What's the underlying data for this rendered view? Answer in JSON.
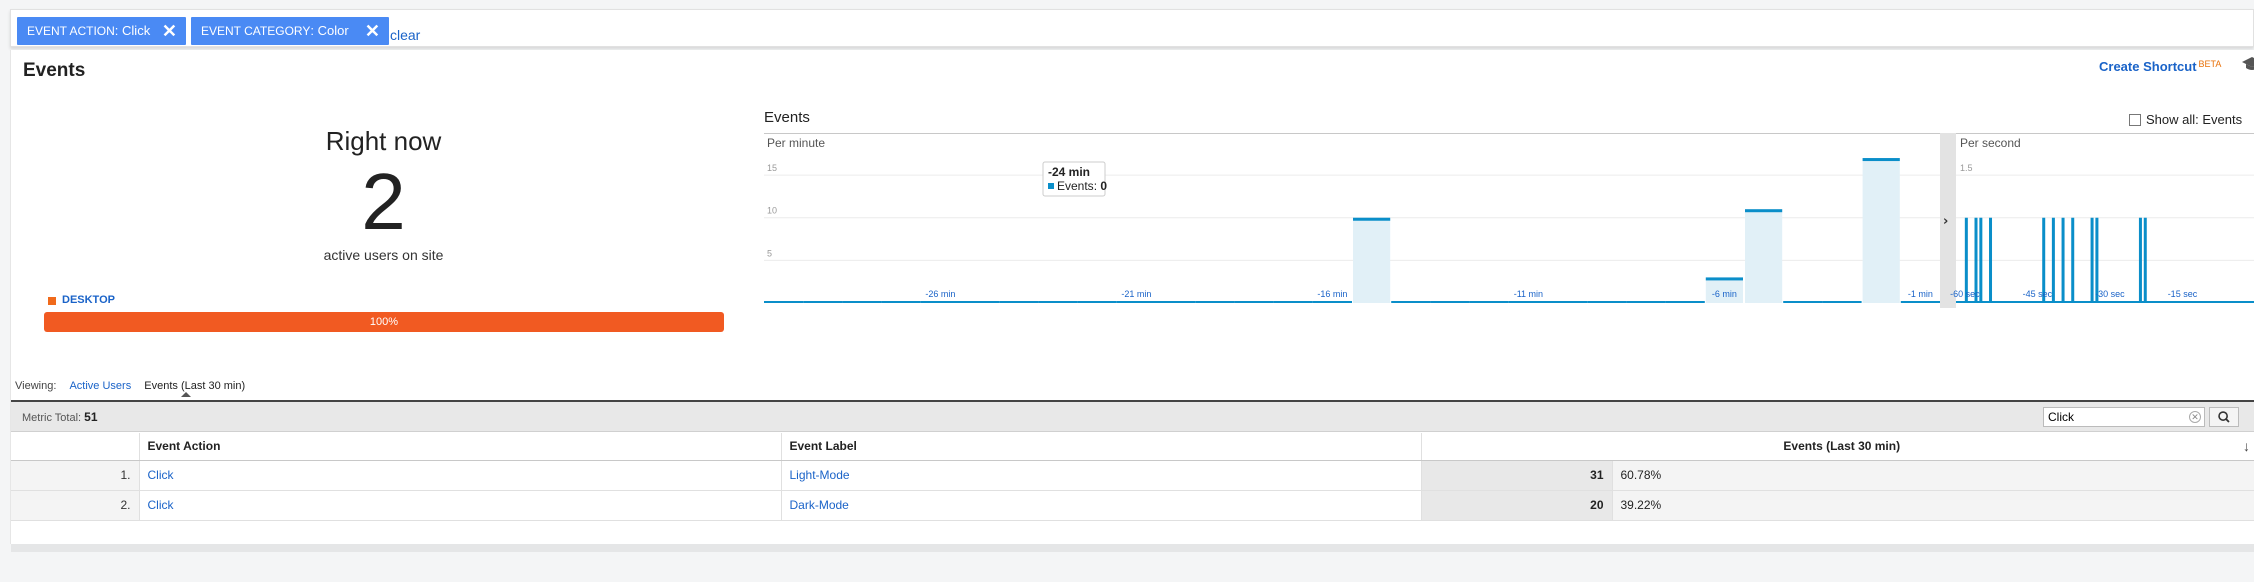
{
  "filters": [
    {
      "key": "EVENT ACTION",
      "value": "Click"
    },
    {
      "key": "EVENT CATEGORY",
      "value": "Color"
    }
  ],
  "clear_label": "clear",
  "page_title": "Events",
  "shortcut": {
    "label": "Create Shortcut",
    "badge": "BETA"
  },
  "right_now": {
    "label": "Right now",
    "count": "2",
    "sublabel": "active users on site",
    "device": "DESKTOP",
    "device_percent": "100%",
    "device_color": "#f15a22"
  },
  "events_panel": {
    "title": "Events",
    "show_all": "Show all: Events",
    "per_minute": "Per minute",
    "per_second": "Per second",
    "tooltip": {
      "title": "-24 min",
      "series": "Events",
      "value": "0"
    }
  },
  "chart_data": [
    {
      "type": "bar",
      "title": "Per minute",
      "x": [
        -30,
        -29,
        -28,
        -27,
        -26,
        -25,
        -24,
        -23,
        -22,
        -21,
        -20,
        -19,
        -18,
        -17,
        -16,
        -15,
        -14,
        -13,
        -12,
        -11,
        -10,
        -9,
        -8,
        -7,
        -6,
        -5,
        -4,
        -3,
        -2,
        -1
      ],
      "values": [
        0,
        0,
        0,
        0,
        0,
        0,
        0,
        0,
        0,
        0,
        0,
        0,
        0,
        0,
        0,
        10,
        0,
        0,
        0,
        0,
        0,
        0,
        0,
        0,
        3,
        11,
        0,
        0,
        17,
        0
      ],
      "x_ticks": [
        "-26 min",
        "-21 min",
        "-16 min",
        "-11 min",
        "-6 min",
        "-1 min"
      ],
      "y_ticks": [
        "5",
        "10",
        "15"
      ],
      "ylim": [
        0,
        19
      ],
      "color": "#0a8ec9",
      "fill": "#e1f0f7"
    },
    {
      "type": "bar",
      "title": "Per second",
      "x_ticks": [
        "-60 sec",
        "-45 sec",
        "-30 sec",
        "-15 sec"
      ],
      "y_ticks": [
        "1.5"
      ],
      "spikes_sec": [
        -60,
        -58,
        -57,
        -55,
        -44,
        -42,
        -40,
        -38,
        -34,
        -33,
        -24,
        -23
      ],
      "spike_value": 1,
      "ylim": [
        0,
        1.9
      ],
      "color": "#0a8ec9"
    }
  ],
  "viewing": {
    "label": "Viewing:",
    "tab_active_users": "Active Users",
    "tab_events": "Events (Last 30 min)"
  },
  "metric_total": {
    "label": "Metric Total:",
    "value": "51"
  },
  "search": {
    "value": "Click"
  },
  "table": {
    "headers": [
      "Event Action",
      "Event Label",
      "Events (Last 30 min)"
    ],
    "rows": [
      {
        "idx": "1.",
        "action": "Click",
        "label": "Light-Mode",
        "events": "31",
        "pct": "60.78%"
      },
      {
        "idx": "2.",
        "action": "Click",
        "label": "Dark-Mode",
        "events": "20",
        "pct": "39.22%"
      }
    ]
  }
}
